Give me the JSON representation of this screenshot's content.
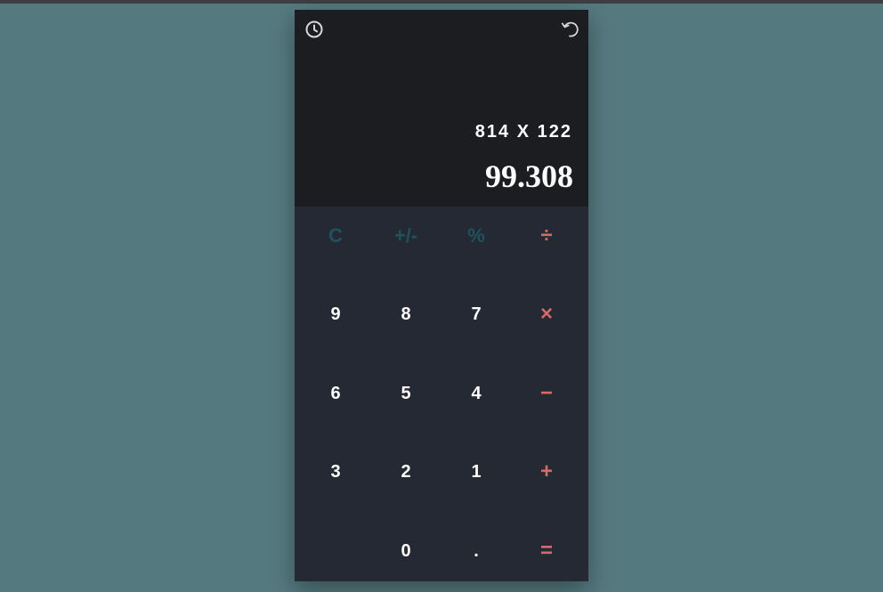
{
  "display": {
    "history_icon": "history-clock-icon",
    "undo_icon": "undo-icon",
    "expression": "814 X 122",
    "result": "99.308"
  },
  "keys": {
    "clear": "C",
    "sign": "+/-",
    "percent": "%",
    "divide": "÷",
    "nine": "9",
    "eight": "8",
    "seven": "7",
    "multiply": "×",
    "six": "6",
    "five": "5",
    "four": "4",
    "minus": "−",
    "three": "3",
    "two": "2",
    "one": "1",
    "plus": "+",
    "zero": "0",
    "decimal": ".",
    "equals": "="
  },
  "colors": {
    "page_background": "#547a7f",
    "display_background": "#1b1d21",
    "keypad_background": "#252933",
    "function_key": "#1d5360",
    "operator_key": "#d66a6a",
    "digit_key": "#ffffff"
  }
}
